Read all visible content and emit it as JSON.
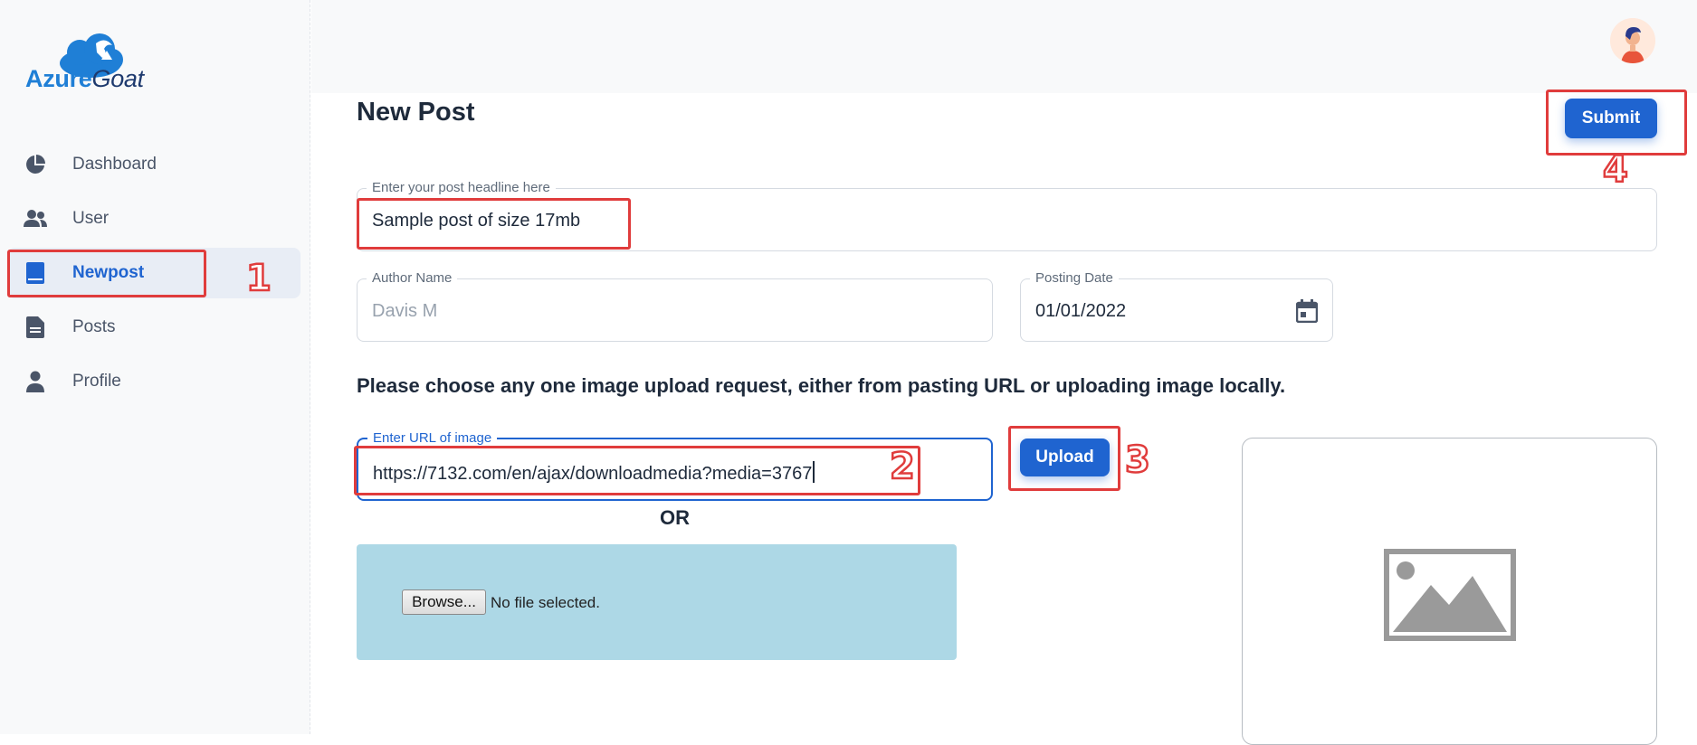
{
  "app": {
    "logo_primary": "Azure",
    "logo_secondary": "Goat"
  },
  "sidebar": {
    "items": [
      {
        "label": "Dashboard",
        "icon": "pie-chart-icon"
      },
      {
        "label": "User",
        "icon": "users-icon"
      },
      {
        "label": "Newpost",
        "icon": "book-icon",
        "active": true
      },
      {
        "label": "Posts",
        "icon": "document-icon"
      },
      {
        "label": "Profile",
        "icon": "person-icon"
      }
    ]
  },
  "header": {
    "avatar_icon": "user-avatar-icon"
  },
  "page": {
    "title": "New Post",
    "submit_label": "Submit",
    "headline": {
      "label": "Enter your post headline here",
      "value": "Sample post of size 17mb"
    },
    "author": {
      "label": "Author Name",
      "value": "Davis M"
    },
    "date": {
      "label": "Posting Date",
      "value": "01/01/2022",
      "icon": "calendar-icon"
    },
    "instruction": "Please choose any one image upload request, either from pasting URL or uploading image locally.",
    "url": {
      "label": "Enter URL of image",
      "value": "https://7132.com/en/ajax/downloadmedia?media=3767"
    },
    "upload_label": "Upload",
    "or_label": "OR",
    "file": {
      "browse_label": "Browse...",
      "status": "No file selected."
    },
    "preview_icon": "image-placeholder-icon"
  },
  "annotations": [
    "1",
    "2",
    "3",
    "4"
  ],
  "colors": {
    "accent": "#1f64d0",
    "annotation": "#e03c3c",
    "dropzone": "#add8e6",
    "sidebar_bg": "#f8f9fa"
  }
}
